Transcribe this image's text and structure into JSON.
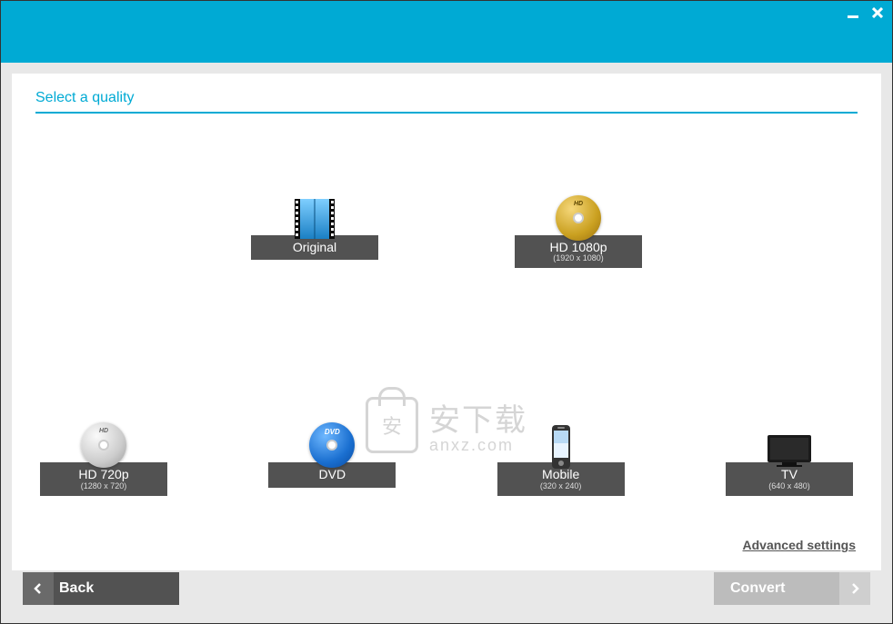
{
  "header": {
    "title": "Select a quality"
  },
  "quality_options": {
    "original": {
      "label": "Original",
      "sub": ""
    },
    "hd1080": {
      "label": "HD 1080p",
      "sub": "(1920 x 1080)"
    },
    "hd720": {
      "label": "HD 720p",
      "sub": "(1280 x 720)"
    },
    "dvd": {
      "label": "DVD",
      "sub": ""
    },
    "mobile": {
      "label": "Mobile",
      "sub": "(320 x 240)"
    },
    "tv": {
      "label": "TV",
      "sub": "(640 x 480)"
    }
  },
  "watermark": {
    "main": "安下载",
    "sub": "anxz.com",
    "shield_char": "安"
  },
  "footer": {
    "advanced": "Advanced settings",
    "back": "Back",
    "convert": "Convert"
  },
  "disc_text": {
    "hd": "HD",
    "dvd": "DVD"
  }
}
